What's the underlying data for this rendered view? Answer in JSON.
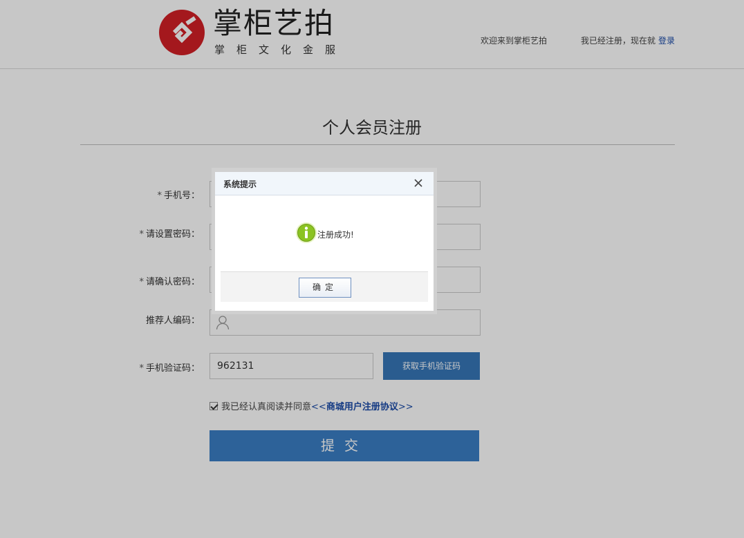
{
  "header": {
    "logo_title": "掌柜艺拍",
    "logo_subtitle": "掌柜文化金服",
    "welcome": "欢迎来到掌柜艺拍",
    "registered_prompt": "我已经注册，现在就",
    "login_link": "登录"
  },
  "form": {
    "title": "个人会员注册",
    "fields": [
      {
        "label": "手机号：",
        "required": "*",
        "value": ""
      },
      {
        "label": "请设置密码：",
        "required": "*",
        "value": ""
      },
      {
        "label": "请确认密码：",
        "required": "*",
        "value": ""
      },
      {
        "label": "推荐人编码：",
        "required": "",
        "value": ""
      }
    ],
    "sms": {
      "label": "手机验证码：",
      "required": "*",
      "value": "962131",
      "button": "获取手机验证码"
    },
    "agreement": {
      "text": "我已经认真阅读并同意",
      "open": "<<",
      "link": "商城用户注册协议",
      "close": ">>",
      "checked": true
    },
    "submit": "提交"
  },
  "dialog": {
    "title": "系统提示",
    "message": "注册成功!",
    "ok": "确定"
  },
  "colors": {
    "brand_red": "#d21f26",
    "button_blue": "#3776b8",
    "link_blue": "#1a4ba8",
    "info_green": "#8bc322"
  }
}
